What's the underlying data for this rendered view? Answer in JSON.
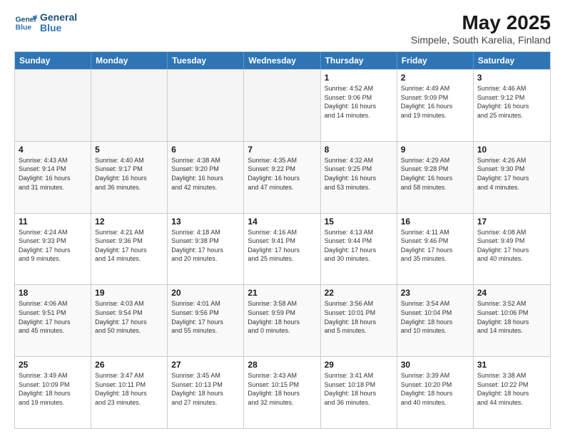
{
  "logo": {
    "line1": "General",
    "line2": "Blue"
  },
  "title": "May 2025",
  "subtitle": "Simpele, South Karelia, Finland",
  "header_days": [
    "Sunday",
    "Monday",
    "Tuesday",
    "Wednesday",
    "Thursday",
    "Friday",
    "Saturday"
  ],
  "weeks": [
    [
      {
        "day": "",
        "info": "",
        "empty": true
      },
      {
        "day": "",
        "info": "",
        "empty": true
      },
      {
        "day": "",
        "info": "",
        "empty": true
      },
      {
        "day": "",
        "info": "",
        "empty": true
      },
      {
        "day": "1",
        "info": "Sunrise: 4:52 AM\nSunset: 9:06 PM\nDaylight: 16 hours\nand 14 minutes."
      },
      {
        "day": "2",
        "info": "Sunrise: 4:49 AM\nSunset: 9:09 PM\nDaylight: 16 hours\nand 19 minutes."
      },
      {
        "day": "3",
        "info": "Sunrise: 4:46 AM\nSunset: 9:12 PM\nDaylight: 16 hours\nand 25 minutes."
      }
    ],
    [
      {
        "day": "4",
        "info": "Sunrise: 4:43 AM\nSunset: 9:14 PM\nDaylight: 16 hours\nand 31 minutes."
      },
      {
        "day": "5",
        "info": "Sunrise: 4:40 AM\nSunset: 9:17 PM\nDaylight: 16 hours\nand 36 minutes."
      },
      {
        "day": "6",
        "info": "Sunrise: 4:38 AM\nSunset: 9:20 PM\nDaylight: 16 hours\nand 42 minutes."
      },
      {
        "day": "7",
        "info": "Sunrise: 4:35 AM\nSunset: 9:22 PM\nDaylight: 16 hours\nand 47 minutes."
      },
      {
        "day": "8",
        "info": "Sunrise: 4:32 AM\nSunset: 9:25 PM\nDaylight: 16 hours\nand 53 minutes."
      },
      {
        "day": "9",
        "info": "Sunrise: 4:29 AM\nSunset: 9:28 PM\nDaylight: 16 hours\nand 58 minutes."
      },
      {
        "day": "10",
        "info": "Sunrise: 4:26 AM\nSunset: 9:30 PM\nDaylight: 17 hours\nand 4 minutes."
      }
    ],
    [
      {
        "day": "11",
        "info": "Sunrise: 4:24 AM\nSunset: 9:33 PM\nDaylight: 17 hours\nand 9 minutes."
      },
      {
        "day": "12",
        "info": "Sunrise: 4:21 AM\nSunset: 9:36 PM\nDaylight: 17 hours\nand 14 minutes."
      },
      {
        "day": "13",
        "info": "Sunrise: 4:18 AM\nSunset: 9:38 PM\nDaylight: 17 hours\nand 20 minutes."
      },
      {
        "day": "14",
        "info": "Sunrise: 4:16 AM\nSunset: 9:41 PM\nDaylight: 17 hours\nand 25 minutes."
      },
      {
        "day": "15",
        "info": "Sunrise: 4:13 AM\nSunset: 9:44 PM\nDaylight: 17 hours\nand 30 minutes."
      },
      {
        "day": "16",
        "info": "Sunrise: 4:11 AM\nSunset: 9:46 PM\nDaylight: 17 hours\nand 35 minutes."
      },
      {
        "day": "17",
        "info": "Sunrise: 4:08 AM\nSunset: 9:49 PM\nDaylight: 17 hours\nand 40 minutes."
      }
    ],
    [
      {
        "day": "18",
        "info": "Sunrise: 4:06 AM\nSunset: 9:51 PM\nDaylight: 17 hours\nand 45 minutes."
      },
      {
        "day": "19",
        "info": "Sunrise: 4:03 AM\nSunset: 9:54 PM\nDaylight: 17 hours\nand 50 minutes."
      },
      {
        "day": "20",
        "info": "Sunrise: 4:01 AM\nSunset: 9:56 PM\nDaylight: 17 hours\nand 55 minutes."
      },
      {
        "day": "21",
        "info": "Sunrise: 3:58 AM\nSunset: 9:59 PM\nDaylight: 18 hours\nand 0 minutes."
      },
      {
        "day": "22",
        "info": "Sunrise: 3:56 AM\nSunset: 10:01 PM\nDaylight: 18 hours\nand 5 minutes."
      },
      {
        "day": "23",
        "info": "Sunrise: 3:54 AM\nSunset: 10:04 PM\nDaylight: 18 hours\nand 10 minutes."
      },
      {
        "day": "24",
        "info": "Sunrise: 3:52 AM\nSunset: 10:06 PM\nDaylight: 18 hours\nand 14 minutes."
      }
    ],
    [
      {
        "day": "25",
        "info": "Sunrise: 3:49 AM\nSunset: 10:09 PM\nDaylight: 18 hours\nand 19 minutes."
      },
      {
        "day": "26",
        "info": "Sunrise: 3:47 AM\nSunset: 10:11 PM\nDaylight: 18 hours\nand 23 minutes."
      },
      {
        "day": "27",
        "info": "Sunrise: 3:45 AM\nSunset: 10:13 PM\nDaylight: 18 hours\nand 27 minutes."
      },
      {
        "day": "28",
        "info": "Sunrise: 3:43 AM\nSunset: 10:15 PM\nDaylight: 18 hours\nand 32 minutes."
      },
      {
        "day": "29",
        "info": "Sunrise: 3:41 AM\nSunset: 10:18 PM\nDaylight: 18 hours\nand 36 minutes."
      },
      {
        "day": "30",
        "info": "Sunrise: 3:39 AM\nSunset: 10:20 PM\nDaylight: 18 hours\nand 40 minutes."
      },
      {
        "day": "31",
        "info": "Sunrise: 3:38 AM\nSunset: 10:22 PM\nDaylight: 18 hours\nand 44 minutes."
      }
    ]
  ]
}
